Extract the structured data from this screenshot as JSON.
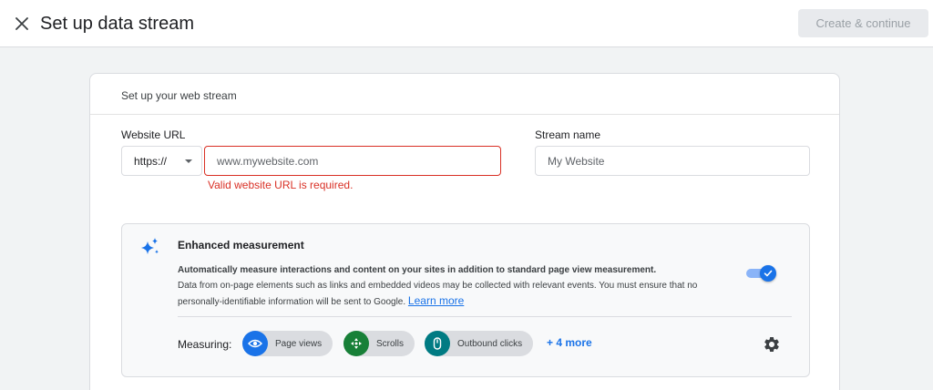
{
  "header": {
    "title": "Set up data stream",
    "create_label": "Create & continue"
  },
  "card": {
    "heading": "Set up your web stream",
    "website_url": {
      "label": "Website URL",
      "protocol": "https://",
      "placeholder": "www.mywebsite.com",
      "error": "Valid website URL is required."
    },
    "stream_name": {
      "label": "Stream name",
      "placeholder": "My Website"
    }
  },
  "enhanced": {
    "title": "Enhanced measurement",
    "desc_bold": "Automatically measure interactions and content on your sites in addition to standard page view measurement.",
    "desc": "Data from on-page elements such as links and embedded videos may be collected with relevant events. You must ensure that no personally-identifiable information will be sent to Google.",
    "learn_more": "Learn more",
    "toggle_on": true,
    "measuring_label": "Measuring:",
    "chips": [
      {
        "label": "Page views",
        "icon": "eye-icon",
        "color": "#1a73e8"
      },
      {
        "label": "Scrolls",
        "icon": "scroll-icon",
        "color": "#188038"
      },
      {
        "label": "Outbound clicks",
        "icon": "mouse-icon",
        "color": "#007b83"
      }
    ],
    "more": "+ 4 more"
  },
  "colors": {
    "accent": "#1a73e8",
    "error": "#d93025"
  }
}
